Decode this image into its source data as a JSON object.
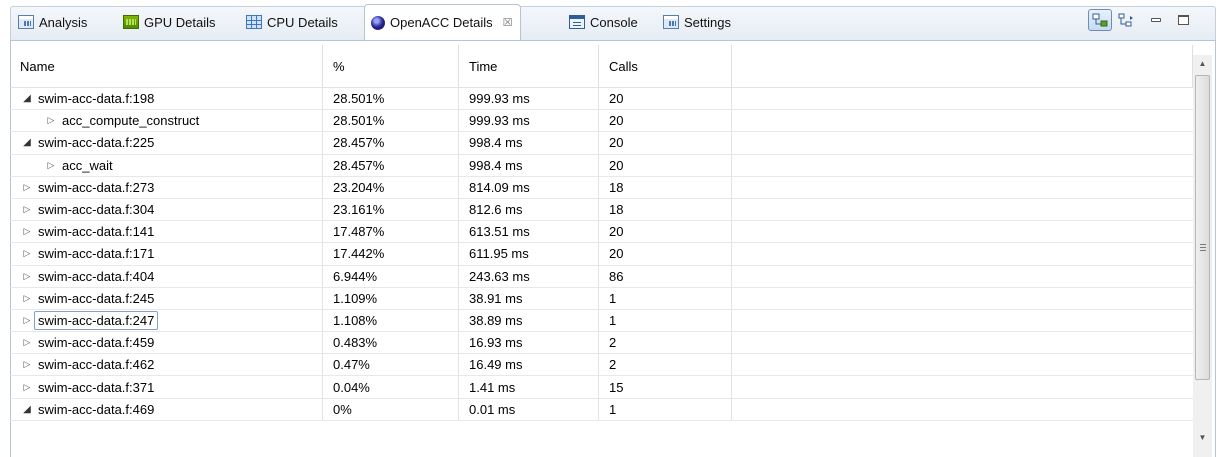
{
  "tabs": [
    {
      "label": "Analysis",
      "icon": "analysis-icon",
      "active": false
    },
    {
      "label": "GPU Details",
      "icon": "gpu-details-icon",
      "active": false
    },
    {
      "label": "CPU Details",
      "icon": "cpu-details-icon",
      "active": false
    },
    {
      "label": "OpenACC Details",
      "icon": "openacc-icon",
      "active": true,
      "close": "☒"
    },
    {
      "label": "Console",
      "icon": "console-icon",
      "active": false
    },
    {
      "label": "Settings",
      "icon": "settings-icon",
      "active": false
    }
  ],
  "toolbar": {
    "toggle_icon": "show-hierarchy-icon",
    "plain_icon": "expand-tree-icon",
    "minimize_icon": "minimize-icon",
    "maximize_icon": "maximize-icon"
  },
  "table": {
    "headers": {
      "name": "Name",
      "percent": "%",
      "time": "Time",
      "calls": "Calls"
    },
    "rows": [
      {
        "name": "swim-acc-data.f:198",
        "percent": "28.501%",
        "time": "999.93 ms",
        "calls": "20",
        "level": 0,
        "state": "expanded"
      },
      {
        "name": "acc_compute_construct",
        "percent": "28.501%",
        "time": "999.93 ms",
        "calls": "20",
        "level": 1,
        "state": "collapsed"
      },
      {
        "name": "swim-acc-data.f:225",
        "percent": "28.457%",
        "time": "998.4 ms",
        "calls": "20",
        "level": 0,
        "state": "expanded"
      },
      {
        "name": "acc_wait",
        "percent": "28.457%",
        "time": "998.4 ms",
        "calls": "20",
        "level": 1,
        "state": "collapsed"
      },
      {
        "name": "swim-acc-data.f:273",
        "percent": "23.204%",
        "time": "814.09 ms",
        "calls": "18",
        "level": 0,
        "state": "collapsed"
      },
      {
        "name": "swim-acc-data.f:304",
        "percent": "23.161%",
        "time": "812.6 ms",
        "calls": "18",
        "level": 0,
        "state": "collapsed"
      },
      {
        "name": "swim-acc-data.f:141",
        "percent": "17.487%",
        "time": "613.51 ms",
        "calls": "20",
        "level": 0,
        "state": "collapsed"
      },
      {
        "name": "swim-acc-data.f:171",
        "percent": "17.442%",
        "time": "611.95 ms",
        "calls": "20",
        "level": 0,
        "state": "collapsed"
      },
      {
        "name": "swim-acc-data.f:404",
        "percent": "6.944%",
        "time": "243.63 ms",
        "calls": "86",
        "level": 0,
        "state": "collapsed"
      },
      {
        "name": "swim-acc-data.f:245",
        "percent": "1.109%",
        "time": "38.91 ms",
        "calls": "1",
        "level": 0,
        "state": "collapsed"
      },
      {
        "name": "swim-acc-data.f:247",
        "percent": "1.108%",
        "time": "38.89 ms",
        "calls": "1",
        "level": 0,
        "state": "collapsed",
        "focused": true
      },
      {
        "name": "swim-acc-data.f:459",
        "percent": "0.483%",
        "time": "16.93 ms",
        "calls": "2",
        "level": 0,
        "state": "collapsed"
      },
      {
        "name": "swim-acc-data.f:462",
        "percent": "0.47%",
        "time": "16.49 ms",
        "calls": "2",
        "level": 0,
        "state": "collapsed"
      },
      {
        "name": "swim-acc-data.f:371",
        "percent": "0.04%",
        "time": "1.41 ms",
        "calls": "15",
        "level": 0,
        "state": "collapsed"
      },
      {
        "name": "swim-acc-data.f:469",
        "percent": "0%",
        "time": "0.01 ms",
        "calls": "1",
        "level": 0,
        "state": "expanded"
      }
    ]
  },
  "glyphs": {
    "expanded": "◢",
    "collapsed": "▷",
    "scroll_up": "▲",
    "scroll_down": "▼"
  }
}
